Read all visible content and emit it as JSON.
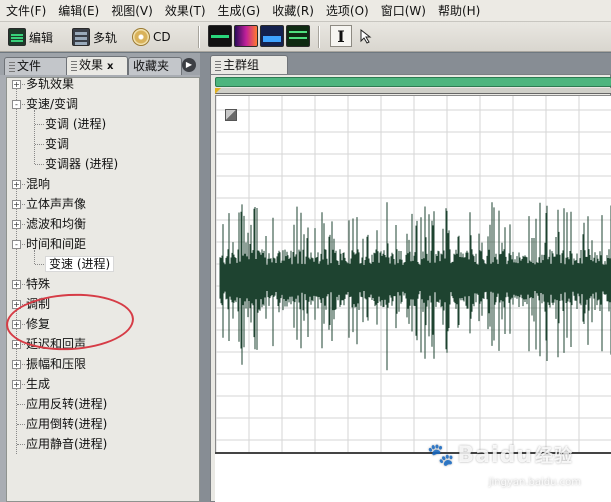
{
  "menu": [
    "文件(F)",
    "编辑(E)",
    "视图(V)",
    "效果(T)",
    "生成(G)",
    "收藏(R)",
    "选项(O)",
    "窗口(W)",
    "帮助(H)"
  ],
  "toolbar": {
    "edit_label": "编辑",
    "multitrack_label": "多轨",
    "cd_label": "CD",
    "view_buttons": [
      "waveform-view-icon",
      "spectral-view-icon",
      "pan-view-icon",
      "phase-view-icon"
    ],
    "tools": [
      "time-selection-tool-icon",
      "marquee-tool-icon"
    ]
  },
  "left_panel": {
    "tabs": [
      "文件",
      "效果",
      "收藏夹"
    ],
    "tab_close": "x",
    "tree": [
      {
        "label": "多轨效果",
        "expander": "+",
        "level": 0
      },
      {
        "label": "变速/变调",
        "expander": "-",
        "level": 0
      },
      {
        "label": "变调 (进程)",
        "level": 1
      },
      {
        "label": "变调",
        "level": 1
      },
      {
        "label": "变调器 (进程)",
        "level": 1
      },
      {
        "label": "混响",
        "expander": "+",
        "level": 0
      },
      {
        "label": "立体声声像",
        "expander": "+",
        "level": 0
      },
      {
        "label": "滤波和均衡",
        "expander": "+",
        "level": 0
      },
      {
        "label": "时间和间距",
        "expander": "-",
        "level": 0
      },
      {
        "label": "变速 (进程)",
        "level": 1,
        "selected": true
      },
      {
        "label": "特殊",
        "expander": "+",
        "level": 0
      },
      {
        "label": "调制",
        "expander": "+",
        "level": 0
      },
      {
        "label": "修复",
        "expander": "+",
        "level": 0
      },
      {
        "label": "延迟和回声",
        "expander": "+",
        "level": 0
      },
      {
        "label": "振幅和压限",
        "expander": "+",
        "level": 0
      },
      {
        "label": "生成",
        "expander": "+",
        "level": 0
      },
      {
        "label": "应用反转(进程)",
        "level": 0
      },
      {
        "label": "应用倒转(进程)",
        "level": 0
      },
      {
        "label": "应用静音(进程)",
        "level": 0
      }
    ]
  },
  "right_panel": {
    "tab_label": "主群组",
    "waveform_color": "#1e4330",
    "timeline_color": "#4db57e"
  },
  "watermark": {
    "brand": "Bai",
    "brand2": "du",
    "sub": "经验",
    "url": "jingyan.baidu.com"
  },
  "annotation_color": "#d63c46"
}
